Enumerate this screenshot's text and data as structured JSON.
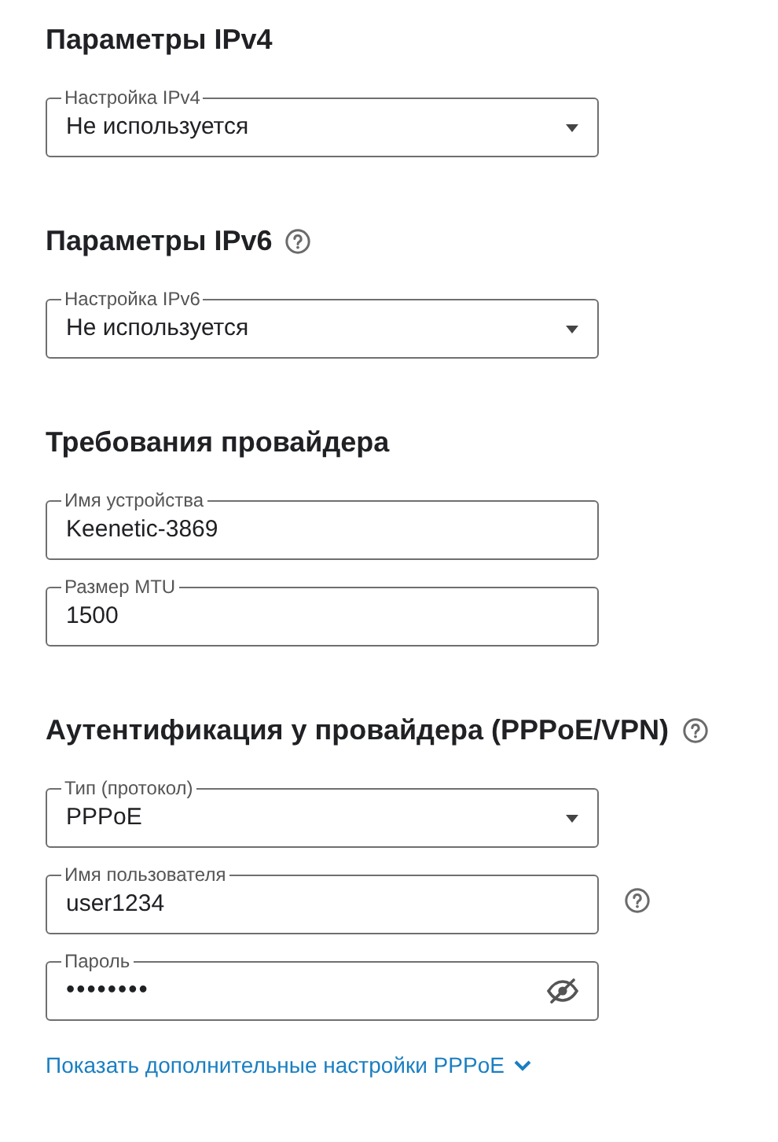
{
  "sections": [
    {
      "title": "Параметры IPv4",
      "help": false,
      "fields": [
        {
          "kind": "select",
          "label": "Настройка IPv4",
          "value": "Не используется",
          "help": false
        }
      ]
    },
    {
      "title": "Параметры IPv6",
      "help": true,
      "fields": [
        {
          "kind": "select",
          "label": "Настройка IPv6",
          "value": "Не используется",
          "help": false
        }
      ]
    },
    {
      "title": "Требования провайдера",
      "help": false,
      "fields": [
        {
          "kind": "text",
          "label": "Имя устройства",
          "value": "Keenetic-3869",
          "help": false
        },
        {
          "kind": "text",
          "label": "Размер MTU",
          "value": "1500",
          "help": false
        }
      ]
    },
    {
      "title": "Аутентификация у провайдера (PPPoE/VPN)",
      "help": true,
      "fields": [
        {
          "kind": "select",
          "label": "Тип (протокол)",
          "value": "PPPoE",
          "help": false
        },
        {
          "kind": "text",
          "label": "Имя пользователя",
          "value": "user1234",
          "help": true
        },
        {
          "kind": "password",
          "label": "Пароль",
          "value": "••••••••",
          "help": false
        }
      ]
    }
  ],
  "more_link": {
    "label": "Показать дополнительные настройки PPPoE",
    "expanded": false
  }
}
